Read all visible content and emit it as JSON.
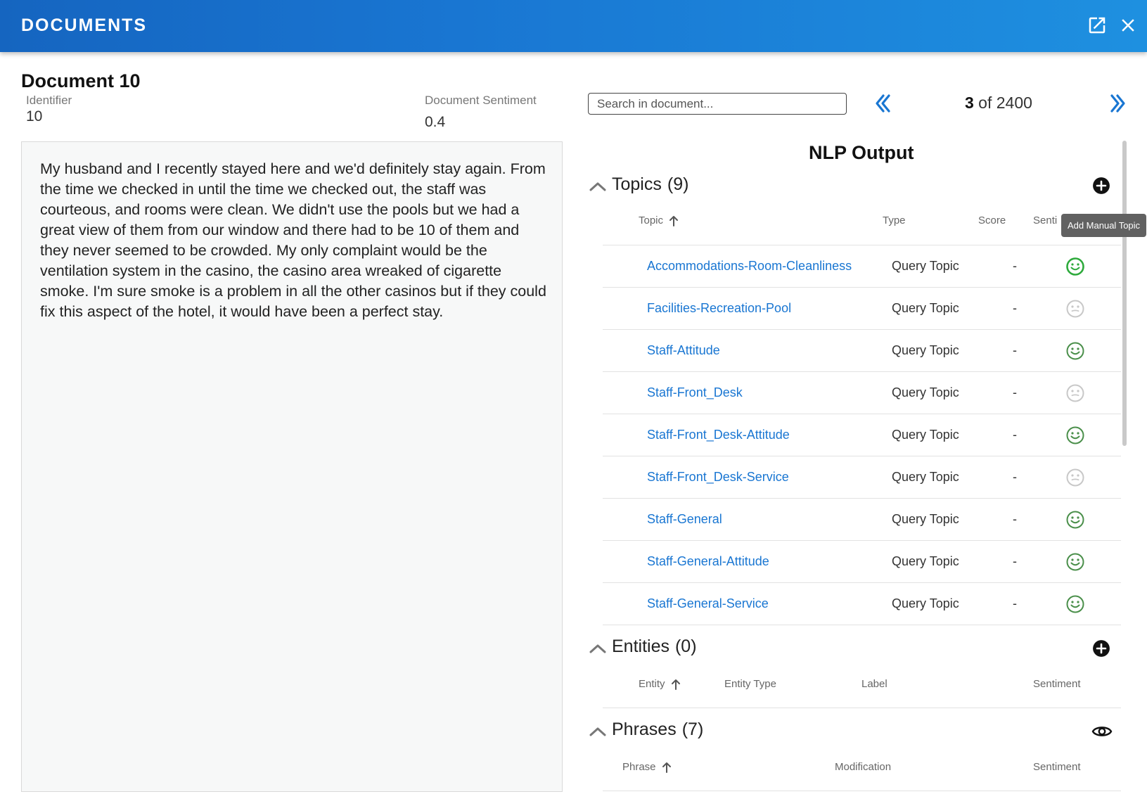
{
  "header": {
    "title": "DOCUMENTS",
    "open_icon": "open-in-new-icon",
    "close_icon": "close-icon"
  },
  "document": {
    "title": "Document 10",
    "identifier_label": "Identifier",
    "identifier_value": "10",
    "sentiment_label": "Document Sentiment",
    "sentiment_value": "0.4",
    "text": "My husband and I recently stayed here and we'd definitely stay again. From the time we checked in until the time we checked out, the staff was courteous, and rooms were clean. We didn't use the pools but we had a great view of them from our window and there had to be 10 of them and they never seemed to be crowded. My only complaint would be the ventilation system in the casino, the casino area wreaked of cigarette smoke. I'm sure smoke is a problem in all the other casinos but if they could fix this aspect of the hotel, it would have been a perfect stay."
  },
  "search": {
    "placeholder": "Search in document..."
  },
  "pager": {
    "current": "3",
    "of_total": " of 2400"
  },
  "nlp": {
    "title": "NLP Output",
    "topics": {
      "label": "Topics",
      "count": "(9)",
      "tooltip": "Add Manual Topic",
      "columns": {
        "topic": "Topic",
        "type": "Type",
        "score": "Score",
        "sentiment": "Senti"
      },
      "rows": [
        {
          "topic": "Accommodations-Room-Cleanliness",
          "type": "Query Topic",
          "score": "-",
          "sentiment": "positive-strong"
        },
        {
          "topic": "Facilities-Recreation-Pool",
          "type": "Query Topic",
          "score": "-",
          "sentiment": "neutral"
        },
        {
          "topic": "Staff-Attitude",
          "type": "Query Topic",
          "score": "-",
          "sentiment": "positive"
        },
        {
          "topic": "Staff-Front_Desk",
          "type": "Query Topic",
          "score": "-",
          "sentiment": "neutral"
        },
        {
          "topic": "Staff-Front_Desk-Attitude",
          "type": "Query Topic",
          "score": "-",
          "sentiment": "positive"
        },
        {
          "topic": "Staff-Front_Desk-Service",
          "type": "Query Topic",
          "score": "-",
          "sentiment": "neutral"
        },
        {
          "topic": "Staff-General",
          "type": "Query Topic",
          "score": "-",
          "sentiment": "positive"
        },
        {
          "topic": "Staff-General-Attitude",
          "type": "Query Topic",
          "score": "-",
          "sentiment": "positive"
        },
        {
          "topic": "Staff-General-Service",
          "type": "Query Topic",
          "score": "-",
          "sentiment": "positive"
        }
      ]
    },
    "entities": {
      "label": "Entities",
      "count": "(0)",
      "columns": {
        "entity": "Entity",
        "entity_type": "Entity Type",
        "label": "Label",
        "sentiment": "Sentiment"
      }
    },
    "phrases": {
      "label": "Phrases",
      "count": "(7)",
      "columns": {
        "phrase": "Phrase",
        "modification": "Modification",
        "sentiment": "Sentiment"
      }
    }
  },
  "colors": {
    "header_start": "#1565c0",
    "header_end": "#1e90e0",
    "link": "#1976d2",
    "positive_strong": "#2eaa3c",
    "positive": "#4a8f4a",
    "neutral": "#c8c8c8"
  }
}
